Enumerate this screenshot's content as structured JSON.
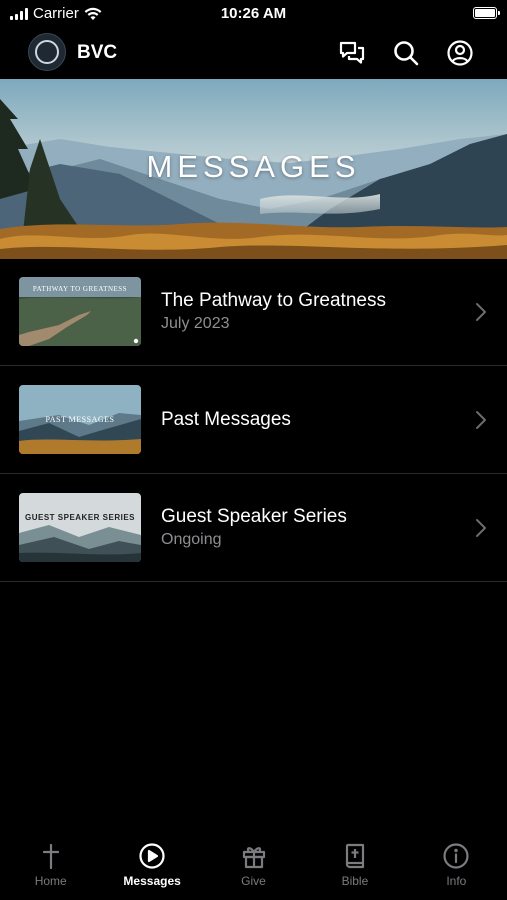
{
  "status_bar": {
    "carrier": "Carrier",
    "time": "10:26 AM"
  },
  "nav": {
    "brand": "BVC",
    "icons": [
      "chat-icon",
      "search-icon",
      "account-icon"
    ]
  },
  "hero": {
    "title": "MESSAGES"
  },
  "items": [
    {
      "title": "The Pathway to Greatness",
      "subtitle": "July 2023",
      "thumb_text": "PATHWAY TO GREATNESS"
    },
    {
      "title": "Past Messages",
      "subtitle": "",
      "thumb_text": "PAST MESSAGES"
    },
    {
      "title": "Guest Speaker Series",
      "subtitle": "Ongoing",
      "thumb_text": "GUEST SPEAKER SERIES"
    }
  ],
  "tabs": [
    {
      "label": "Home",
      "icon": "cross-icon",
      "active": false
    },
    {
      "label": "Messages",
      "icon": "play-circle-icon",
      "active": true
    },
    {
      "label": "Give",
      "icon": "gift-icon",
      "active": false
    },
    {
      "label": "Bible",
      "icon": "bible-icon",
      "active": false
    },
    {
      "label": "Info",
      "icon": "info-icon",
      "active": false
    }
  ],
  "colors": {
    "background": "#000000",
    "text": "#ffffff",
    "secondary_text": "#8e8e93",
    "inactive_tab": "#7b7b80"
  }
}
